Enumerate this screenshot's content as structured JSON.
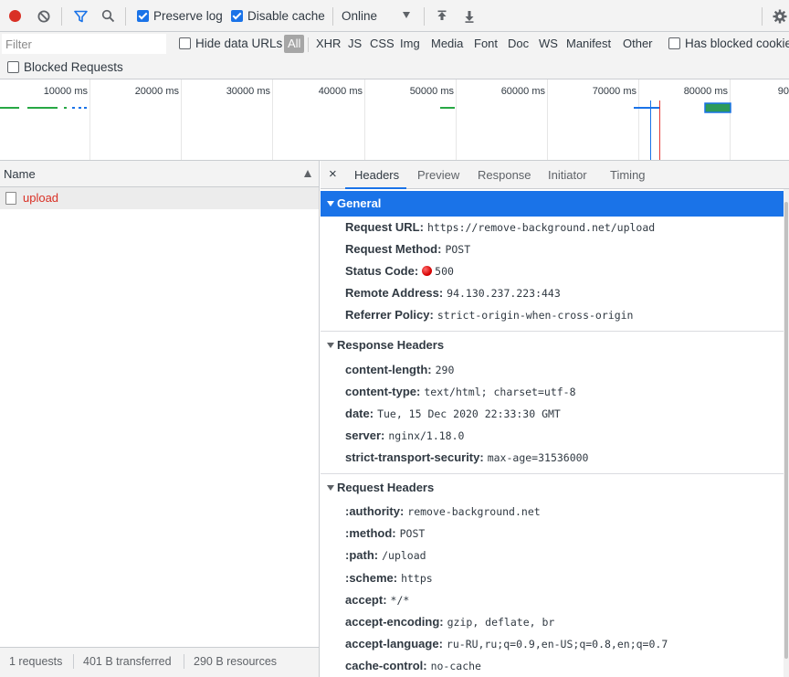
{
  "toolbar": {
    "preserve_log_label": "Preserve log",
    "preserve_log_checked": true,
    "disable_cache_label": "Disable cache",
    "disable_cache_checked": true,
    "throttle_value": "Online",
    "record_color": "#d93025",
    "filter_icon_color": "#1a73e8"
  },
  "filterbar": {
    "filter_placeholder": "Filter",
    "hide_data_urls_label": "Hide data URLs",
    "types": [
      "All",
      "XHR",
      "JS",
      "CSS",
      "Img",
      "Media",
      "Font",
      "Doc",
      "WS",
      "Manifest",
      "Other"
    ],
    "selected_type": "All",
    "has_blocked_cookies_label": "Has blocked cookies",
    "blocked_requests_label": "Blocked Requests"
  },
  "overview": {
    "ticks": [
      "10000 ms",
      "20000 ms",
      "30000 ms",
      "40000 ms",
      "50000 ms",
      "60000 ms",
      "70000 ms",
      "80000 ms",
      "90"
    ]
  },
  "request_list": {
    "column_name": "Name",
    "rows": [
      {
        "name": "upload",
        "status": "error"
      }
    ],
    "error_color": "#d93025"
  },
  "statusbar": {
    "requests": "1 requests",
    "transferred": "401 B transferred",
    "resources": "290 B resources"
  },
  "details": {
    "tabs": [
      "Headers",
      "Preview",
      "Response",
      "Initiator",
      "Timing"
    ],
    "active_tab": "Headers",
    "general": {
      "title": "General",
      "rows": [
        {
          "name": "Request URL:",
          "value": "https://remove-background.net/upload"
        },
        {
          "name": "Request Method:",
          "value": "POST"
        },
        {
          "name": "Status Code:",
          "value": "500"
        },
        {
          "name": "Remote Address:",
          "value": "94.130.237.223:443"
        },
        {
          "name": "Referrer Policy:",
          "value": "strict-origin-when-cross-origin"
        }
      ]
    },
    "response_headers": {
      "title": "Response Headers",
      "rows": [
        {
          "name": "content-length:",
          "value": "290"
        },
        {
          "name": "content-type:",
          "value": "text/html; charset=utf-8"
        },
        {
          "name": "date:",
          "value": "Tue, 15 Dec 2020 22:33:30 GMT"
        },
        {
          "name": "server:",
          "value": "nginx/1.18.0"
        },
        {
          "name": "strict-transport-security:",
          "value": "max-age=31536000"
        }
      ]
    },
    "request_headers": {
      "title": "Request Headers",
      "rows": [
        {
          "name": ":authority:",
          "value": "remove-background.net"
        },
        {
          "name": ":method:",
          "value": "POST"
        },
        {
          "name": ":path:",
          "value": "/upload"
        },
        {
          "name": ":scheme:",
          "value": "https"
        },
        {
          "name": "accept:",
          "value": "*/*"
        },
        {
          "name": "accept-encoding:",
          "value": "gzip, deflate, br"
        },
        {
          "name": "accept-language:",
          "value": "ru-RU,ru;q=0.9,en-US;q=0.8,en;q=0.7"
        },
        {
          "name": "cache-control:",
          "value": "no-cache"
        }
      ]
    }
  }
}
